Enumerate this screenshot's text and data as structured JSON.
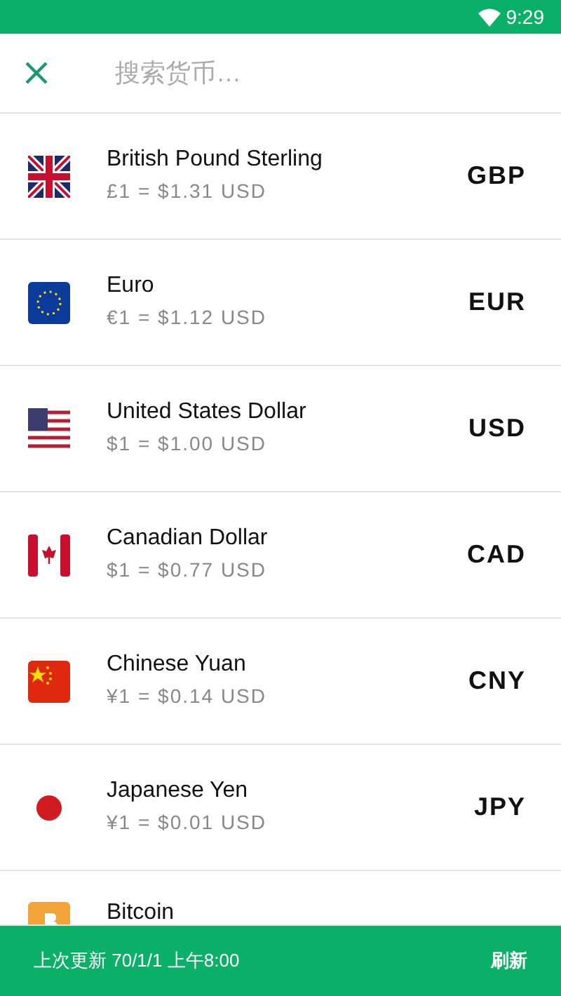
{
  "status_bar": {
    "time": "9:29"
  },
  "search": {
    "placeholder": "搜索货币…"
  },
  "currencies": [
    {
      "kind": "gb",
      "name": "British Pound Sterling",
      "rate": "£1 = $1.31 USD",
      "code": "GBP"
    },
    {
      "kind": "eu",
      "name": "Euro",
      "rate": "€1 = $1.12 USD",
      "code": "EUR"
    },
    {
      "kind": "us",
      "name": "United States Dollar",
      "rate": "$1 = $1.00 USD",
      "code": "USD"
    },
    {
      "kind": "ca",
      "name": "Canadian Dollar",
      "rate": "$1 = $0.77 USD",
      "code": "CAD"
    },
    {
      "kind": "cn",
      "name": "Chinese Yuan",
      "rate": "¥1 = $0.14 USD",
      "code": "CNY"
    },
    {
      "kind": "jp",
      "name": "Japanese Yen",
      "rate": "¥1 = $0.01 USD",
      "code": "JPY"
    },
    {
      "kind": "btc",
      "name": "Bitcoin"
    }
  ],
  "footer": {
    "updated": "上次更新 70/1/1 上午8:00",
    "refresh": "刷新"
  }
}
